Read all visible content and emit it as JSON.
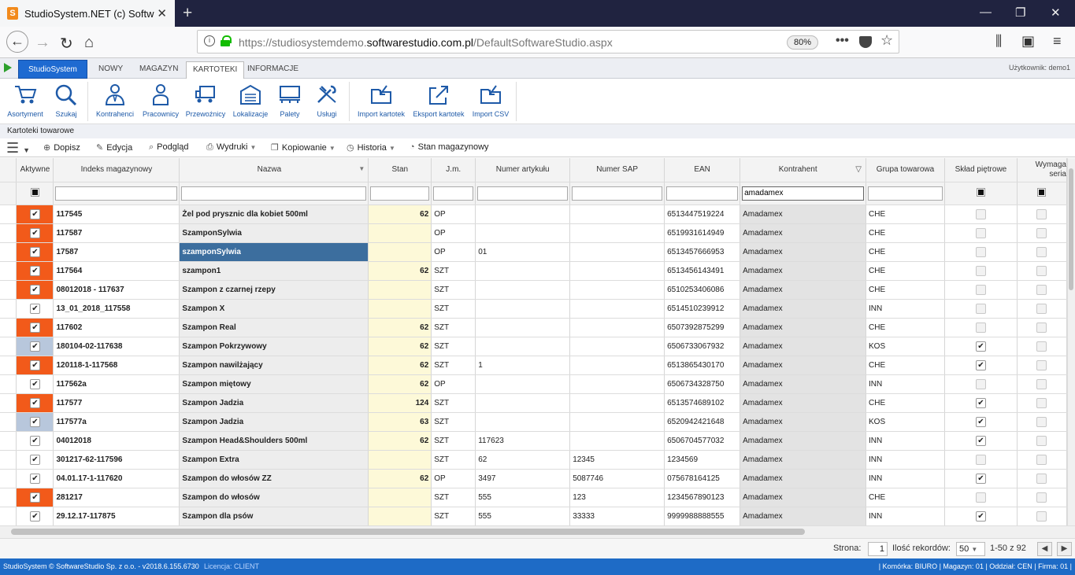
{
  "browser": {
    "tab_title": "StudioSystem.NET (c) Software",
    "url_prefix": "https://studiosystemdemo.",
    "url_domain": "softwarestudio.com.pl",
    "url_path": "/DefaultSoftwareStudio.aspx",
    "zoom": "80%"
  },
  "app": {
    "brand": "StudioSystem",
    "tabs": [
      "NOWY",
      "MAGAZYN",
      "KARTOTEKI",
      "INFORMACJE"
    ],
    "active_tab": "KARTOTEKI",
    "user": "Użytkownik: demo1"
  },
  "ribbon": [
    "Asortyment",
    "Szukaj",
    "Kontrahenci",
    "Pracownicy",
    "Przewoźnicy",
    "Lokalizacje",
    "Palety",
    "Usługi",
    "Import kartotek",
    "Eksport kartotek",
    "Import CSV"
  ],
  "breadcrumb": "Kartoteki towarowe",
  "toolbar": [
    "Dopisz",
    "Edycja",
    "Podgląd",
    "Wydruki",
    "Kopiowanie",
    "Historia",
    "Stan magazynowy"
  ],
  "columns": [
    "Aktywne",
    "Indeks magazynowy",
    "Nazwa",
    "Stan",
    "J.m.",
    "Numer artykułu",
    "Numer SAP",
    "EAN",
    "Kontrahent",
    "Grupa towarowa",
    "Skład piętrowe",
    "Wymaga seria"
  ],
  "filter_kontrahent": "amadamex",
  "rows": [
    {
      "a": "orange",
      "idx": "117545",
      "nm": "Żel pod prysznic dla kobiet 500ml",
      "st": "62",
      "jm": "OP",
      "art": "",
      "sap": "",
      "ean": "6513447519224",
      "k": "Amadamex",
      "g": "CHE",
      "sk": false
    },
    {
      "a": "orange",
      "idx": "117587",
      "nm": "SzamponSylwia",
      "st": "",
      "jm": "OP",
      "art": "",
      "sap": "",
      "ean": "6519931614949",
      "k": "Amadamex",
      "g": "CHE",
      "sk": false
    },
    {
      "a": "orange",
      "idx": "17587",
      "nm": "szamponSylwia",
      "st": "",
      "jm": "OP",
      "art": "01",
      "sap": "",
      "ean": "6513457666953",
      "k": "Amadamex",
      "g": "CHE",
      "sk": false,
      "sel": true
    },
    {
      "a": "orange",
      "idx": "117564",
      "nm": "szampon1",
      "st": "62",
      "jm": "SZT",
      "art": "",
      "sap": "",
      "ean": "6513456143491",
      "k": "Amadamex",
      "g": "CHE",
      "sk": false
    },
    {
      "a": "orange",
      "idx": "08012018 - 117637",
      "nm": "Szampon z czarnej rzepy",
      "st": "",
      "jm": "SZT",
      "art": "",
      "sap": "",
      "ean": "6510253406086",
      "k": "Amadamex",
      "g": "CHE",
      "sk": false
    },
    {
      "a": "white",
      "idx": "13_01_2018_117558",
      "nm": "Szampon X",
      "st": "",
      "jm": "SZT",
      "art": "",
      "sap": "",
      "ean": "6514510239912",
      "k": "Amadamex",
      "g": "INN",
      "sk": false
    },
    {
      "a": "orange",
      "idx": "117602",
      "nm": "Szampon Real",
      "st": "62",
      "jm": "SZT",
      "art": "",
      "sap": "",
      "ean": "6507392875299",
      "k": "Amadamex",
      "g": "CHE",
      "sk": false
    },
    {
      "a": "blue",
      "idx": "180104-02-117638",
      "nm": "Szampon Pokrzywowy",
      "st": "62",
      "jm": "SZT",
      "art": "",
      "sap": "",
      "ean": "6506733067932",
      "k": "Amadamex",
      "g": "KOS",
      "sk": true
    },
    {
      "a": "orange",
      "idx": "120118-1-117568",
      "nm": "Szampon nawilżający",
      "st": "62",
      "jm": "SZT",
      "art": "1",
      "sap": "",
      "ean": "6513865430170",
      "k": "Amadamex",
      "g": "CHE",
      "sk": true
    },
    {
      "a": "white",
      "idx": "117562a",
      "nm": "Szampon miętowy",
      "st": "62",
      "jm": "OP",
      "art": "",
      "sap": "",
      "ean": "6506734328750",
      "k": "Amadamex",
      "g": "INN",
      "sk": false
    },
    {
      "a": "orange",
      "idx": "117577",
      "nm": "Szampon Jadzia",
      "st": "124",
      "jm": "SZT",
      "art": "",
      "sap": "",
      "ean": "6513574689102",
      "k": "Amadamex",
      "g": "CHE",
      "sk": true
    },
    {
      "a": "blue",
      "idx": "117577a",
      "nm": "Szampon Jadzia",
      "st": "63",
      "jm": "SZT",
      "art": "",
      "sap": "",
      "ean": "6520942421648",
      "k": "Amadamex",
      "g": "KOS",
      "sk": true
    },
    {
      "a": "white",
      "idx": "04012018",
      "nm": "Szampon Head&Shoulders 500ml",
      "st": "62",
      "jm": "SZT",
      "art": "117623",
      "sap": "",
      "ean": "6506704577032",
      "k": "Amadamex",
      "g": "INN",
      "sk": true
    },
    {
      "a": "white",
      "idx": "301217-62-117596",
      "nm": "Szampon Extra",
      "st": "",
      "jm": "SZT",
      "art": "62",
      "sap": "12345",
      "ean": "1234569",
      "k": "Amadamex",
      "g": "INN",
      "sk": false
    },
    {
      "a": "white",
      "idx": "04.01.17-1-117620",
      "nm": "Szampon do włosów ZZ",
      "st": "62",
      "jm": "OP",
      "art": "3497",
      "sap": "5087746",
      "ean": "075678164125",
      "k": "Amadamex",
      "g": "INN",
      "sk": true
    },
    {
      "a": "orange",
      "idx": "281217",
      "nm": "Szampon do włosów",
      "st": "",
      "jm": "SZT",
      "art": "555",
      "sap": "123",
      "ean": "1234567890123",
      "k": "Amadamex",
      "g": "CHE",
      "sk": false
    },
    {
      "a": "white",
      "idx": "29.12.17-117875",
      "nm": "Szampon dla psów",
      "st": "",
      "jm": "SZT",
      "art": "555",
      "sap": "33333",
      "ean": "9999988888555",
      "k": "Amadamex",
      "g": "INN",
      "sk": true
    }
  ],
  "pager": {
    "page_label": "Strona:",
    "page": "1",
    "count_label": "Ilość rekordów:",
    "count": "50",
    "range": "1-50 z 92"
  },
  "status": {
    "left": "StudioSystem © SoftwareStudio Sp. z o.o. - v2018.6.155.6730",
    "license": "Licencja: CLIENT",
    "right": "| Komórka: BIURO | Magazyn: 01 | Oddział: CEN | Firma: 01 |"
  }
}
